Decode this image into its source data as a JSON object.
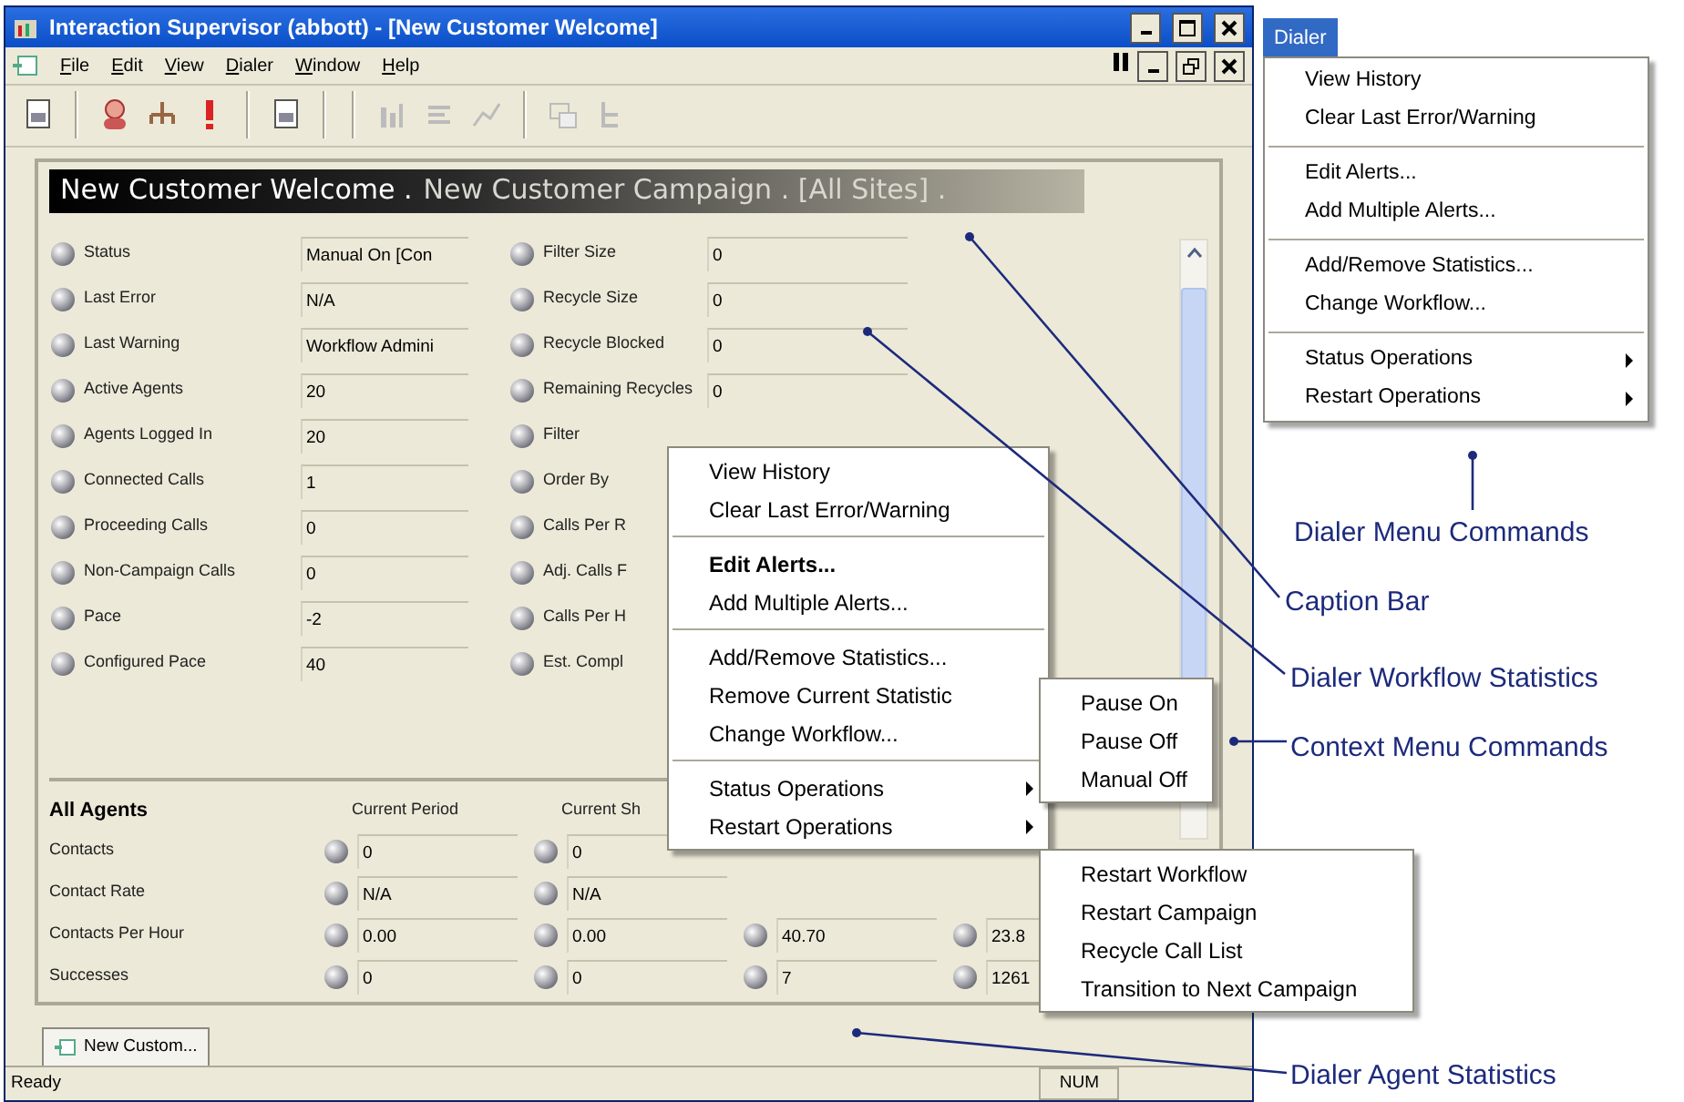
{
  "window": {
    "title": "Interaction Supervisor (abbott) - [New Customer Welcome]"
  },
  "menu": [
    "File",
    "Edit",
    "View",
    "Dialer",
    "Window",
    "Help"
  ],
  "caption": {
    "title": "New Customer Welcome .",
    "subtitle": "New Customer Campaign . [All Sites] ."
  },
  "workflow_stats": {
    "left": [
      {
        "label": "Status",
        "value": "Manual On [Con"
      },
      {
        "label": "Last Error",
        "value": "N/A"
      },
      {
        "label": "Last Warning",
        "value": "Workflow Admini"
      },
      {
        "label": "Active Agents",
        "value": "20"
      },
      {
        "label": "Agents Logged In",
        "value": "20"
      },
      {
        "label": "Connected Calls",
        "value": "1"
      },
      {
        "label": "Proceeding Calls",
        "value": "0"
      },
      {
        "label": "Non-Campaign Calls",
        "value": "0"
      },
      {
        "label": "Pace",
        "value": "-2"
      },
      {
        "label": "Configured Pace",
        "value": "40"
      }
    ],
    "right": [
      {
        "label": "Filter Size",
        "value": "0"
      },
      {
        "label": "Recycle Size",
        "value": "0"
      },
      {
        "label": "Recycle Blocked",
        "value": "0"
      },
      {
        "label": "Remaining Recycles",
        "value": "0"
      },
      {
        "label": "Filter"
      },
      {
        "label": "Order By"
      },
      {
        "label": "Calls Per R"
      },
      {
        "label": "Adj. Calls F"
      },
      {
        "label": "Calls Per H"
      },
      {
        "label": "Est. Compl"
      }
    ]
  },
  "agent_stats": {
    "title": "All Agents",
    "columns": [
      "Current Period",
      "Current Sh"
    ],
    "rows": [
      {
        "label": "Contacts",
        "values": [
          "0",
          "0"
        ]
      },
      {
        "label": "Contact Rate",
        "values": [
          "N/A",
          "N/A"
        ]
      },
      {
        "label": "Contacts Per Hour",
        "values": [
          "0.00",
          "0.00",
          "40.70",
          "23.8"
        ]
      },
      {
        "label": "Successes",
        "values": [
          "0",
          "0",
          "7",
          "1261"
        ]
      }
    ]
  },
  "tabs": [
    {
      "label": "New Custom...",
      "selected": true
    }
  ],
  "status_bar": {
    "text": "Ready",
    "indicators": [
      "NUM"
    ]
  },
  "context_menu": [
    [
      {
        "label": "View History",
        "bold": false,
        "submenu": false
      },
      {
        "label": "Clear Last Error/Warning",
        "bold": false,
        "submenu": false
      }
    ],
    [
      {
        "label": "Edit Alerts...",
        "bold": true,
        "submenu": false
      },
      {
        "label": "Add Multiple Alerts...",
        "bold": false,
        "submenu": false
      }
    ],
    [
      {
        "label": "Add/Remove Statistics...",
        "bold": false,
        "submenu": false
      },
      {
        "label": "Remove Current Statistic",
        "bold": false,
        "submenu": false
      },
      {
        "label": "Change Workflow...",
        "bold": false,
        "submenu": false
      }
    ],
    [
      {
        "label": "Status Operations",
        "bold": false,
        "submenu": true
      },
      {
        "label": "Restart Operations",
        "bold": false,
        "submenu": true
      }
    ]
  ],
  "status_submenu": [
    "Pause On",
    "Pause Off",
    "Manual Off"
  ],
  "restart_submenu": [
    "Restart Workflow",
    "Restart Campaign",
    "Recycle Call List",
    "Transition to Next Campaign"
  ],
  "dialer_menu": {
    "title": "Dialer",
    "groups": [
      [
        {
          "label": "View History",
          "submenu": false
        },
        {
          "label": "Clear Last Error/Warning",
          "submenu": false
        }
      ],
      [
        {
          "label": "Edit Alerts...",
          "submenu": false
        },
        {
          "label": "Add Multiple Alerts...",
          "submenu": false
        }
      ],
      [
        {
          "label": "Add/Remove Statistics...",
          "submenu": false
        },
        {
          "label": "Change Workflow...",
          "submenu": false
        }
      ],
      [
        {
          "label": "Status Operations",
          "submenu": true
        },
        {
          "label": "Restart Operations",
          "submenu": true
        }
      ]
    ]
  },
  "callouts": [
    "Dialer Menu Commands",
    "Caption Bar",
    "Dialer Workflow Statistics",
    "Context Menu Commands",
    "Dialer Agent Statistics"
  ]
}
